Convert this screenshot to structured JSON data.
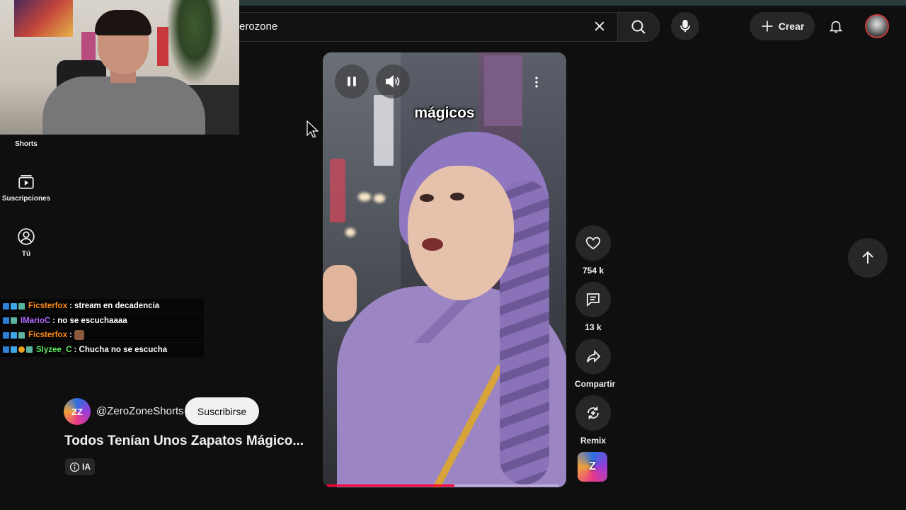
{
  "colors": {
    "accent": "#ff0033",
    "background": "#0f0f0f",
    "button_bg": "#272727"
  },
  "search": {
    "value": "erozone"
  },
  "header": {
    "create_label": "Crear"
  },
  "sidebar": {
    "items": [
      {
        "label": "Shorts",
        "icon": "shorts-icon"
      },
      {
        "label": "Suscripciones",
        "icon": "subscriptions-icon"
      },
      {
        "label": "Tú",
        "icon": "you-icon"
      }
    ]
  },
  "chat": {
    "messages": [
      {
        "user": "Ficsterfox",
        "user_color": "#ff8c1a",
        "text": ": stream en decadencia"
      },
      {
        "user": "IMarioC",
        "user_color": "#b066ff",
        "text": ": no se escuchaaaa"
      },
      {
        "user": "Ficsterfox",
        "user_color": "#ff8c1a",
        "text": ":"
      },
      {
        "user": "Slyzee_C",
        "user_color": "#5ee85e",
        "text": ": Chucha no se escucha"
      }
    ]
  },
  "video": {
    "caption": "mágicos",
    "progress": 0.55
  },
  "actions": {
    "like_count": "754 k",
    "comment_count": "13 k",
    "share_label": "Compartir",
    "remix_label": "Remix"
  },
  "meta": {
    "channel_handle": "@ZeroZoneShorts",
    "subscribe_label": "Suscribirse",
    "title": "Todos Tenían Unos Zapatos Mágico...",
    "ai_badge": "IA"
  }
}
